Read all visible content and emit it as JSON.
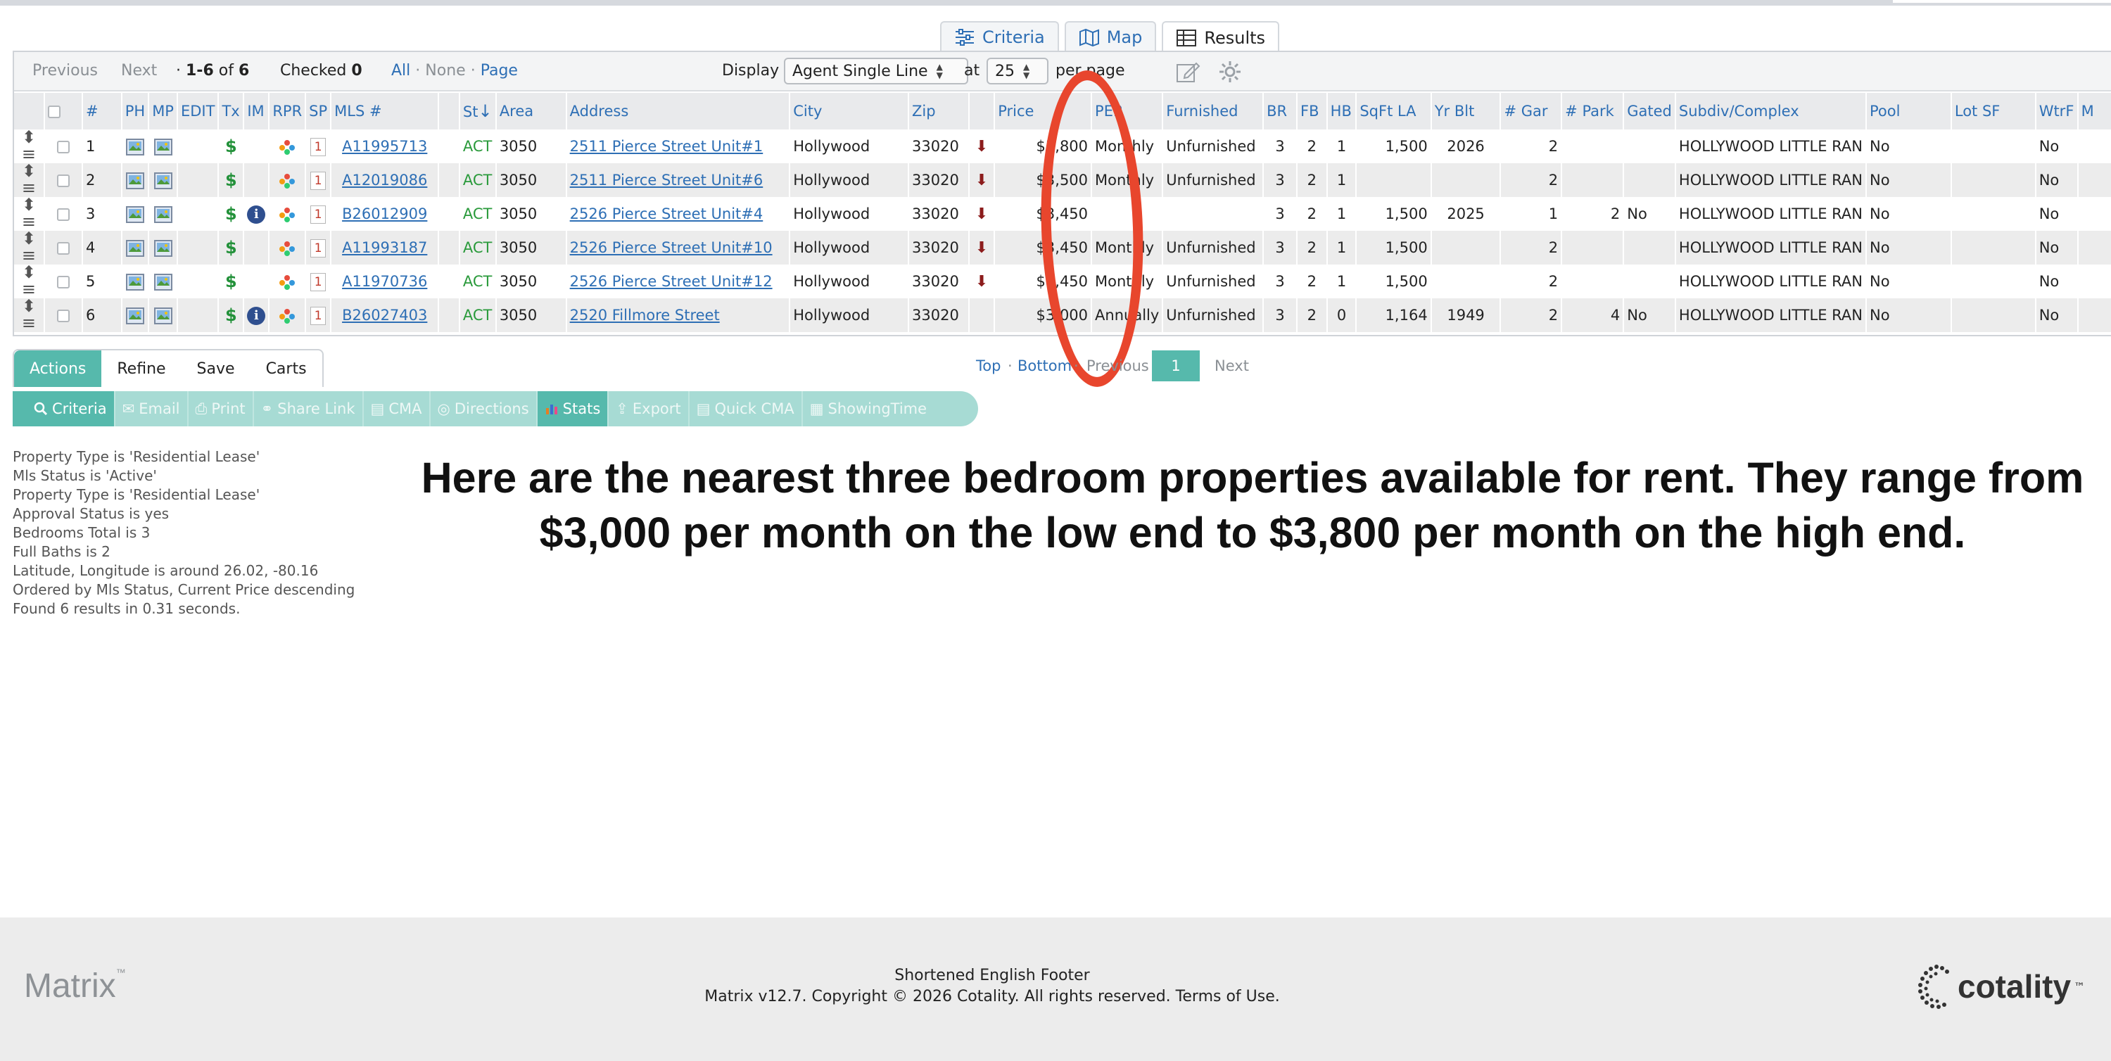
{
  "view_tabs": [
    {
      "label": "Criteria",
      "icon": "sliders-icon"
    },
    {
      "label": "Map",
      "icon": "map-icon"
    },
    {
      "label": "Results",
      "icon": "table-icon",
      "active": true
    }
  ],
  "toolbar": {
    "previous": "Previous",
    "next": "Next",
    "range_prefix": "·",
    "range": "1-6",
    "of": "of",
    "total": "6",
    "checked_label": "Checked",
    "checked_count": "0",
    "all": "All",
    "sep": "·",
    "none": "None",
    "page": "Page",
    "display_label": "Display",
    "display_value": "Agent Single Line",
    "at_label": "at",
    "per_page_value": "25",
    "per_page_label": "per page"
  },
  "table": {
    "headers": {
      "num": "#",
      "ph": "PH",
      "mp": "MP",
      "edit": "EDIT",
      "tx": "Tx",
      "im": "IM",
      "rpr": "RPR",
      "sp": "SP",
      "mls": "MLS #",
      "st": "St",
      "area": "Area",
      "address": "Address",
      "city": "City",
      "zip": "Zip",
      "price": "Price",
      "per": "PER",
      "furnished": "Furnished",
      "br": "BR",
      "fb": "FB",
      "hb": "HB",
      "sqft": "SqFt LA",
      "yrblt": "Yr Blt",
      "gar": "# Gar",
      "park": "# Park",
      "gated": "Gated",
      "subdiv": "Subdiv/Complex",
      "pool": "Pool",
      "lotsf": "Lot SF",
      "wtrf": "WtrF",
      "m": "M"
    },
    "rows": [
      {
        "num": "1",
        "mls": "A11995713",
        "st": "ACT",
        "area": "3050",
        "address": "2511 Pierce Street Unit#1",
        "city": "Hollywood",
        "zip": "33020",
        "price": "$3,800",
        "per": "Monthly",
        "furnished": "Unfurnished",
        "br": "3",
        "fb": "2",
        "hb": "1",
        "sqft": "1,500",
        "yrblt": "2026",
        "gar": "2",
        "park": "",
        "gated": "",
        "subdiv": "HOLLYWOOD LITTLE RAN",
        "pool": "No",
        "wtrf": "No",
        "info": false,
        "down": true
      },
      {
        "num": "2",
        "mls": "A12019086",
        "st": "ACT",
        "area": "3050",
        "address": "2511 Pierce Street Unit#6",
        "city": "Hollywood",
        "zip": "33020",
        "price": "$3,500",
        "per": "Monthly",
        "furnished": "Unfurnished",
        "br": "3",
        "fb": "2",
        "hb": "1",
        "sqft": "",
        "yrblt": "",
        "gar": "2",
        "park": "",
        "gated": "",
        "subdiv": "HOLLYWOOD LITTLE RAN",
        "pool": "No",
        "wtrf": "No",
        "info": false,
        "down": true
      },
      {
        "num": "3",
        "mls": "B26012909",
        "st": "ACT",
        "area": "3050",
        "address": "2526 Pierce Street Unit#4",
        "city": "Hollywood",
        "zip": "33020",
        "price": "$3,450",
        "per": "",
        "furnished": "",
        "br": "3",
        "fb": "2",
        "hb": "1",
        "sqft": "1,500",
        "yrblt": "2025",
        "gar": "1",
        "park": "2",
        "gated": "No",
        "subdiv": "HOLLYWOOD LITTLE RAN",
        "pool": "No",
        "wtrf": "No",
        "info": true,
        "down": true
      },
      {
        "num": "4",
        "mls": "A11993187",
        "st": "ACT",
        "area": "3050",
        "address": "2526 Pierce Street Unit#10",
        "city": "Hollywood",
        "zip": "33020",
        "price": "$3,450",
        "per": "Monthly",
        "furnished": "Unfurnished",
        "br": "3",
        "fb": "2",
        "hb": "1",
        "sqft": "1,500",
        "yrblt": "",
        "gar": "2",
        "park": "",
        "gated": "",
        "subdiv": "HOLLYWOOD LITTLE RAN",
        "pool": "No",
        "wtrf": "No",
        "info": false,
        "down": true
      },
      {
        "num": "5",
        "mls": "A11970736",
        "st": "ACT",
        "area": "3050",
        "address": "2526 Pierce Street Unit#12",
        "city": "Hollywood",
        "zip": "33020",
        "price": "$3,450",
        "per": "Monthly",
        "furnished": "Unfurnished",
        "br": "3",
        "fb": "2",
        "hb": "1",
        "sqft": "1,500",
        "yrblt": "",
        "gar": "2",
        "park": "",
        "gated": "",
        "subdiv": "HOLLYWOOD LITTLE RAN",
        "pool": "No",
        "wtrf": "No",
        "info": false,
        "down": true
      },
      {
        "num": "6",
        "mls": "B26027403",
        "st": "ACT",
        "area": "3050",
        "address": "2520 Fillmore Street",
        "city": "Hollywood",
        "zip": "33020",
        "price": "$3,000",
        "per": "Annually",
        "furnished": "Unfurnished",
        "br": "3",
        "fb": "2",
        "hb": "0",
        "sqft": "1,164",
        "yrblt": "1949",
        "gar": "2",
        "park": "4",
        "gated": "No",
        "subdiv": "HOLLYWOOD LITTLE RAN",
        "pool": "No",
        "wtrf": "No",
        "info": true,
        "down": false
      }
    ]
  },
  "action_tabs": [
    "Actions",
    "Refine",
    "Save",
    "Carts"
  ],
  "action_buttons": [
    {
      "label": "Criteria",
      "on": true
    },
    {
      "label": "Email",
      "on": false
    },
    {
      "label": "Print",
      "on": false
    },
    {
      "label": "Share Link",
      "on": false
    },
    {
      "label": "CMA",
      "on": false
    },
    {
      "label": "Directions",
      "on": false
    },
    {
      "label": "Stats",
      "on": true
    },
    {
      "label": "Export",
      "on": false
    },
    {
      "label": "Quick CMA",
      "on": false
    },
    {
      "label": "ShowingTime",
      "on": false
    }
  ],
  "pager": {
    "top": "Top",
    "sep": "·",
    "bottom": "Bottom",
    "previous": "Previous",
    "current": "1",
    "next": "Next"
  },
  "criteria_lines": [
    "Property Type is 'Residential Lease'",
    "Mls Status is 'Active'",
    "Property Type is 'Residential Lease'",
    "Approval Status is yes",
    "Bedrooms Total is 3",
    "Full Baths is 2",
    "Latitude, Longitude is around 26.02, -80.16",
    "Ordered by Mls Status, Current Price descending",
    "Found 6 results in 0.31 seconds."
  ],
  "overlay_text": "Here are the nearest three bedroom properties available for rent. They range from $3,000 per month on the low end to $3,800 per month on the high end.",
  "footer": {
    "logo": "Matrix",
    "tm": "™",
    "line1": "Shortened English Footer",
    "line2": "Matrix v12.7. Copyright © 2026 Cotality. All rights reserved.",
    "terms": "Terms of Use.",
    "brand": "cotality",
    "brand_tm": "™"
  },
  "colors": {
    "link": "#2e6fb5",
    "teal": "#56b9ac",
    "teal_light": "#a7dbd4",
    "active_status": "#2a9a3b",
    "annotation_red": "#e8462d"
  }
}
